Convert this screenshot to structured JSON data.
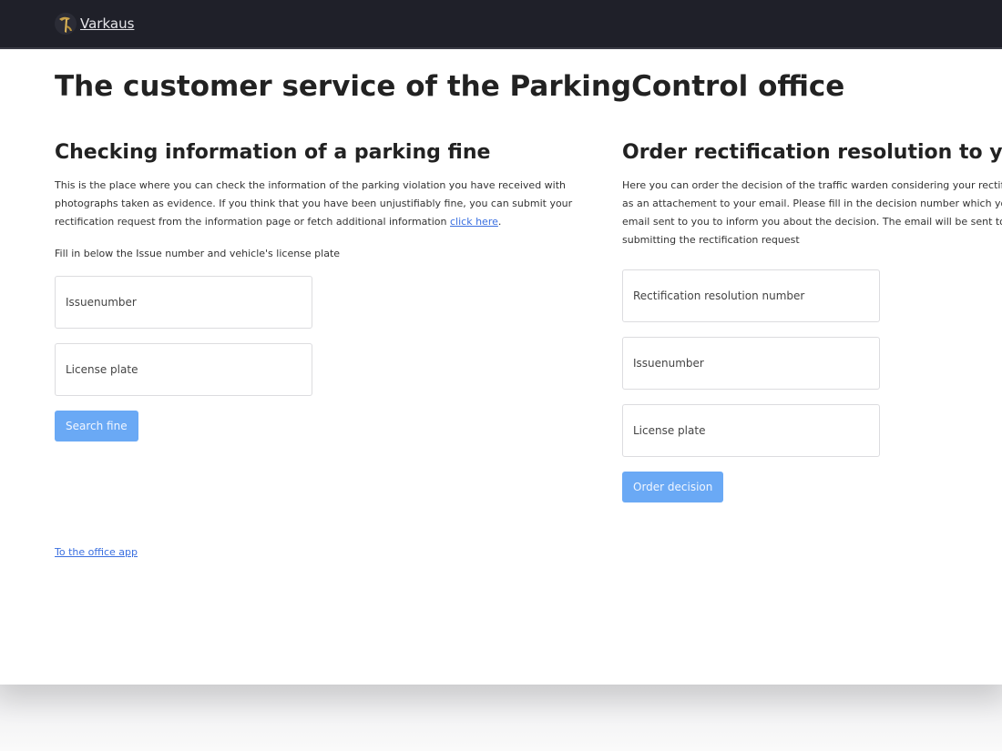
{
  "brand": {
    "name": "Varkaus"
  },
  "page_title": "The customer service of the ParkingControl office",
  "left": {
    "heading": "Checking information of a parking fine",
    "description": "This is the place where you can check the information of the parking violation you have received with photographs taken as evidence. If you think that you have been unjustifiably fine, you can submit your rectification request from the information page or fetch additional information",
    "link_text": "click here",
    "link_suffix": ".",
    "instruction": "Fill in below the Issue number and vehicle's license plate",
    "issue_placeholder": "Issuenumber",
    "plate_placeholder": "License plate",
    "search_label": "Search fine"
  },
  "right": {
    "heading": "Order rectification resolution to your email",
    "description": "Here you can order the decision of the traffic warden considering your rectification request delivered as an attachement to your email. Please fill in the decision number which you can find from the email sent to you to inform you about the decision. The email will be sent to the address used when submitting the rectification request",
    "resolution_placeholder": "Rectification resolution number",
    "issue_placeholder": "Issuenumber",
    "plate_placeholder": "License plate",
    "order_label": "Order decision"
  },
  "footer_link": "To the office app",
  "colors": {
    "navbar": "#1f2029",
    "button": "#6aa9f5",
    "link": "#3a6fe0"
  }
}
